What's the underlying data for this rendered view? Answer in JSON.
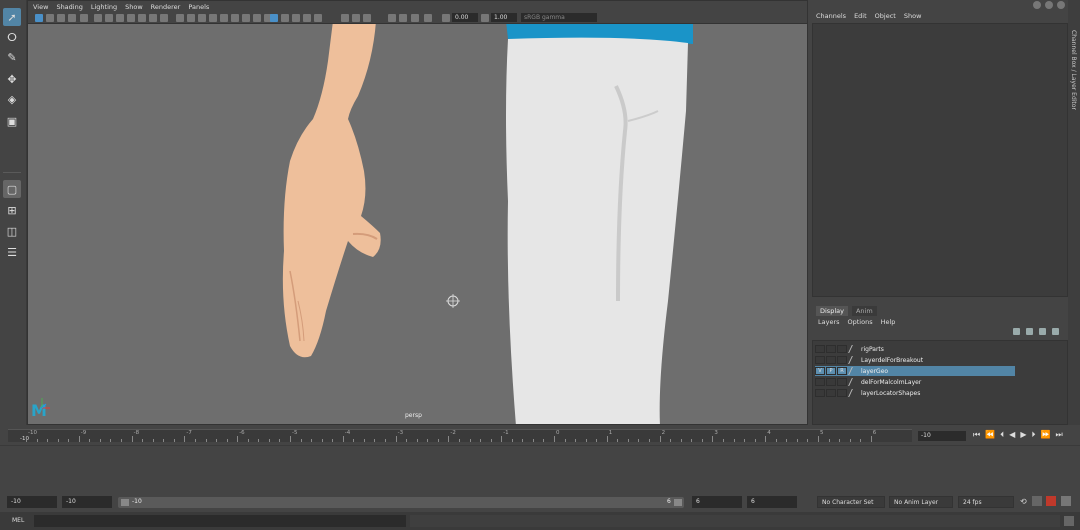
{
  "viewport": {
    "menu": [
      "View",
      "Shading",
      "Lighting",
      "Show",
      "Renderer",
      "Panels"
    ],
    "exposure": "0.00",
    "gamma": "1.00",
    "color_space": "sRGB gamma",
    "camera_label": "persp",
    "logo": "M"
  },
  "channel_box": {
    "menu": [
      "Channels",
      "Edit",
      "Object",
      "Show"
    ],
    "side_tab": "Channel Box / Layer Editor"
  },
  "layer_editor": {
    "tabs": [
      "Display",
      "Anim"
    ],
    "menu": [
      "Layers",
      "Options",
      "Help"
    ],
    "layers": [
      {
        "name": "rigParts",
        "v": "",
        "p": "",
        "r": "",
        "selected": false
      },
      {
        "name": "LayerdelForBreakout",
        "v": "",
        "p": "",
        "r": "",
        "selected": false
      },
      {
        "name": "layerGeo",
        "v": "V",
        "p": "P",
        "r": "R",
        "selected": true
      },
      {
        "name": "delForMalcolmLayer",
        "v": "",
        "p": "",
        "r": "",
        "selected": false
      },
      {
        "name": "layerLocatorShapes",
        "v": "",
        "p": "",
        "r": "",
        "selected": false
      }
    ]
  },
  "timeline": {
    "start_label": "-10",
    "ticks": [
      "-10",
      "-9",
      "-8",
      "-7",
      "-6",
      "-5",
      "-4",
      "-3",
      "-2",
      "-1",
      "0",
      "1",
      "2",
      "3",
      "4",
      "5",
      "6"
    ],
    "current_frame": "-10"
  },
  "range": {
    "start": "-10",
    "playback_start": "-10",
    "slider_start": "-10",
    "slider_end": "6",
    "playback_end": "6",
    "end": "6",
    "character_set": "No Character Set",
    "anim_layer": "No Anim Layer",
    "fps": "24 fps"
  },
  "command_line": {
    "label": "MEL"
  },
  "colors": {
    "viewport_bg": "#6e6e6e",
    "selection": "#5285a6",
    "skin": "#eebf9b",
    "pants": "#e8e8e8",
    "shirt": "#1a94c8",
    "maya_logo": "#29a4c9"
  }
}
